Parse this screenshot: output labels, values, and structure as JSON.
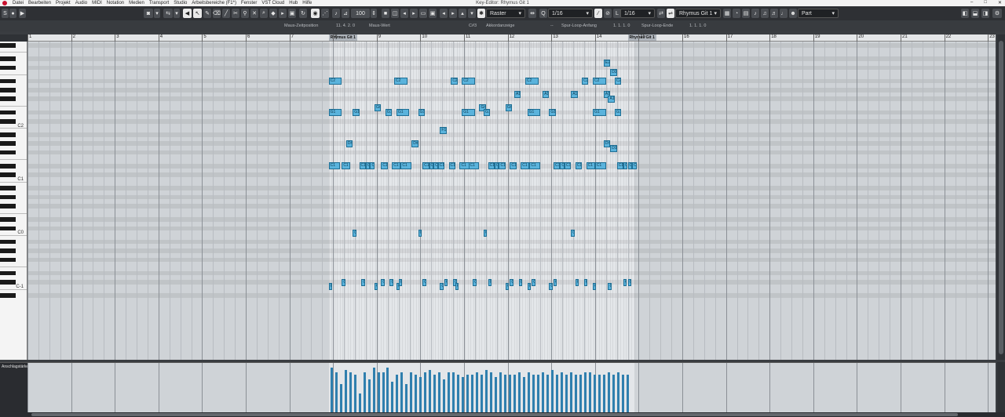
{
  "window": {
    "title": "Key-Editor: Rhymus Git 1"
  },
  "menu": [
    "Datei",
    "Bearbeiten",
    "Projekt",
    "Audio",
    "MIDI",
    "Notation",
    "Medien",
    "Transport",
    "Studio",
    "Arbeitsbereiche (F1*)",
    "Fenster",
    "VST Cloud",
    "Hub",
    "Hilfe"
  ],
  "toolbar": {
    "velocity": "100",
    "quantize_mode": "Raster",
    "quantize_value": "1/16",
    "length_value": "1/16",
    "length_prefix": "L",
    "quantize_prefix": "Q",
    "track": "Rhymus Git 1",
    "part_scope": "Part"
  },
  "infoline": {
    "mouse_pos_label": "Maus-Zeitposition",
    "mouse_pos_value": "11. 4. 2. 0",
    "mouse_value_label": "Maus-Wert",
    "mouse_value_value": "C#3",
    "chord_label": "Akkordanzeige",
    "chord_value": "--",
    "loop_start_label": "Spur-Loop-Anfang",
    "loop_start_value": "1. 1. 1. 0",
    "loop_end_label": "Spur-Loop-Ende",
    "loop_end_value": "1. 1. 1. 0"
  },
  "ruler": {
    "bars": [
      "1",
      "2",
      "3",
      "4",
      "5",
      "6",
      "7",
      "8",
      "9",
      "10",
      "11",
      "12",
      "13",
      "14",
      "15",
      "16",
      "17",
      "18",
      "19",
      "20",
      "21",
      "22",
      "23"
    ],
    "part_label_1": "Rhymus Git 1",
    "part_label_2": "Rhymus Git 1"
  },
  "keyboard": {
    "labels": [
      "C2",
      "C1",
      "C0",
      "C-1"
    ]
  },
  "velocity_lane": {
    "label": "Anschlagstärke"
  },
  "notes": [
    {
      "bar": 7.9,
      "len": 0.3,
      "p": 22,
      "t": "C2"
    },
    {
      "bar": 9.4,
      "len": 0.3,
      "p": 22,
      "t": "C2"
    },
    {
      "bar": 10.7,
      "len": 0.15,
      "p": 22,
      "t": "C2"
    },
    {
      "bar": 10.95,
      "len": 0.3,
      "p": 22,
      "t": "C2"
    },
    {
      "bar": 12.4,
      "len": 0.3,
      "p": 22,
      "t": "C2"
    },
    {
      "bar": 13.7,
      "len": 0.15,
      "p": 22,
      "t": "C2"
    },
    {
      "bar": 13.95,
      "len": 0.3,
      "p": 22,
      "t": "C2"
    },
    {
      "bar": 14.45,
      "len": 0.15,
      "p": 22,
      "t": "C2"
    },
    {
      "bar": 14.2,
      "len": 0.15,
      "p": 26,
      "t": "E2"
    },
    {
      "bar": 14.35,
      "len": 0.15,
      "p": 24,
      "t": "D2"
    },
    {
      "bar": 12.15,
      "len": 0.15,
      "p": 19,
      "t": "A1"
    },
    {
      "bar": 12.8,
      "len": 0.15,
      "p": 19,
      "t": "A1"
    },
    {
      "bar": 13.45,
      "len": 0.15,
      "p": 19,
      "t": "A1"
    },
    {
      "bar": 14.2,
      "len": 0.15,
      "p": 19,
      "t": "A1"
    },
    {
      "bar": 14.3,
      "len": 0.15,
      "p": 18,
      "t": "A1"
    },
    {
      "bar": 8.95,
      "len": 0.15,
      "p": 16,
      "t": "G#1"
    },
    {
      "bar": 11.35,
      "len": 0.15,
      "p": 16,
      "t": "G#1"
    },
    {
      "bar": 11.95,
      "len": 0.15,
      "p": 16,
      "t": "G#1"
    },
    {
      "bar": 7.9,
      "len": 0.3,
      "p": 15,
      "t": "G1"
    },
    {
      "bar": 8.45,
      "len": 0.15,
      "p": 15,
      "t": "G1"
    },
    {
      "bar": 9.2,
      "len": 0.15,
      "p": 15,
      "t": "G1"
    },
    {
      "bar": 9.45,
      "len": 0.3,
      "p": 15,
      "t": "G1"
    },
    {
      "bar": 9.95,
      "len": 0.15,
      "p": 15,
      "t": "G1"
    },
    {
      "bar": 10.95,
      "len": 0.3,
      "p": 15,
      "t": "G1"
    },
    {
      "bar": 11.45,
      "len": 0.15,
      "p": 15,
      "t": "G1"
    },
    {
      "bar": 12.45,
      "len": 0.3,
      "p": 15,
      "t": "G1"
    },
    {
      "bar": 12.95,
      "len": 0.15,
      "p": 15,
      "t": "G1"
    },
    {
      "bar": 13.95,
      "len": 0.3,
      "p": 15,
      "t": "G1"
    },
    {
      "bar": 14.45,
      "len": 0.15,
      "p": 15,
      "t": "G1"
    },
    {
      "bar": 10.45,
      "len": 0.15,
      "p": 11,
      "t": "F1"
    },
    {
      "bar": 8.3,
      "len": 0.15,
      "p": 8,
      "t": "D#1"
    },
    {
      "bar": 9.8,
      "len": 0.15,
      "p": 8,
      "t": "D#1"
    },
    {
      "bar": 14.2,
      "len": 0.15,
      "p": 8,
      "t": "D#1"
    },
    {
      "bar": 14.35,
      "len": 0.15,
      "p": 7,
      "t": "D1"
    },
    {
      "bar": 7.9,
      "len": 0.25,
      "p": 3,
      "t": "C1"
    },
    {
      "bar": 8.2,
      "len": 0.2,
      "p": 3,
      "t": "C1"
    },
    {
      "bar": 8.6,
      "len": 0.15,
      "p": 3,
      "t": "C1"
    },
    {
      "bar": 8.75,
      "len": 0.1,
      "p": 3,
      "t": "C1"
    },
    {
      "bar": 8.85,
      "len": 0.1,
      "p": 3,
      "t": "C1"
    },
    {
      "bar": 9.1,
      "len": 0.15,
      "p": 3,
      "t": "C1"
    },
    {
      "bar": 9.35,
      "len": 0.2,
      "p": 3,
      "t": "C1"
    },
    {
      "bar": 9.55,
      "len": 0.25,
      "p": 3,
      "t": "C1"
    },
    {
      "bar": 10.05,
      "len": 0.15,
      "p": 3,
      "t": "C1"
    },
    {
      "bar": 10.2,
      "len": 0.1,
      "p": 3,
      "t": "C1"
    },
    {
      "bar": 10.3,
      "len": 0.1,
      "p": 3,
      "t": "C1"
    },
    {
      "bar": 10.4,
      "len": 0.15,
      "p": 3,
      "t": "C1"
    },
    {
      "bar": 10.65,
      "len": 0.15,
      "p": 3,
      "t": "C1"
    },
    {
      "bar": 10.9,
      "len": 0.25,
      "p": 3,
      "t": "C1"
    },
    {
      "bar": 11.1,
      "len": 0.25,
      "p": 3,
      "t": "C1"
    },
    {
      "bar": 11.55,
      "len": 0.15,
      "p": 3,
      "t": "C1"
    },
    {
      "bar": 11.7,
      "len": 0.1,
      "p": 3,
      "t": "C1"
    },
    {
      "bar": 11.8,
      "len": 0.15,
      "p": 3,
      "t": "C1"
    },
    {
      "bar": 12.05,
      "len": 0.15,
      "p": 3,
      "t": "C1"
    },
    {
      "bar": 12.3,
      "len": 0.2,
      "p": 3,
      "t": "C1"
    },
    {
      "bar": 12.5,
      "len": 0.25,
      "p": 3,
      "t": "C1"
    },
    {
      "bar": 13.05,
      "len": 0.15,
      "p": 3,
      "t": "C1"
    },
    {
      "bar": 13.2,
      "len": 0.1,
      "p": 3,
      "t": "C1"
    },
    {
      "bar": 13.3,
      "len": 0.15,
      "p": 3,
      "t": "C1"
    },
    {
      "bar": 13.55,
      "len": 0.15,
      "p": 3,
      "t": "C1"
    },
    {
      "bar": 13.8,
      "len": 0.2,
      "p": 3,
      "t": "C1"
    },
    {
      "bar": 14.0,
      "len": 0.25,
      "p": 3,
      "t": "C1"
    },
    {
      "bar": 14.5,
      "len": 0.15,
      "p": 3,
      "t": "C1"
    },
    {
      "bar": 14.65,
      "len": 0.1,
      "p": 3,
      "t": "C1"
    },
    {
      "bar": 14.75,
      "len": 0.1,
      "p": 3,
      "t": "C1"
    },
    {
      "bar": 14.85,
      "len": 0.1,
      "p": 3,
      "t": "C1"
    },
    {
      "bar": 8.45,
      "len": 0.08,
      "p": -12,
      "t": "C"
    },
    {
      "bar": 9.95,
      "len": 0.08,
      "p": -12,
      "t": "C"
    },
    {
      "bar": 11.45,
      "len": 0.08,
      "p": -12,
      "t": "C"
    },
    {
      "bar": 13.45,
      "len": 0.08,
      "p": -12,
      "t": "C"
    },
    {
      "bar": 8.2,
      "len": 0.08,
      "p": -23,
      "t": "C"
    },
    {
      "bar": 8.65,
      "len": 0.08,
      "p": -23,
      "t": "C"
    },
    {
      "bar": 9.1,
      "len": 0.08,
      "p": -23,
      "t": "C"
    },
    {
      "bar": 9.3,
      "len": 0.08,
      "p": -23,
      "t": "C"
    },
    {
      "bar": 9.5,
      "len": 0.08,
      "p": -23,
      "t": "C"
    },
    {
      "bar": 10.05,
      "len": 0.08,
      "p": -23,
      "t": "C"
    },
    {
      "bar": 10.55,
      "len": 0.08,
      "p": -23,
      "t": "C"
    },
    {
      "bar": 10.75,
      "len": 0.08,
      "p": -23,
      "t": "C"
    },
    {
      "bar": 11.2,
      "len": 0.08,
      "p": -23,
      "t": "C"
    },
    {
      "bar": 11.55,
      "len": 0.08,
      "p": -23,
      "t": "C"
    },
    {
      "bar": 12.05,
      "len": 0.08,
      "p": -23,
      "t": "C"
    },
    {
      "bar": 12.25,
      "len": 0.08,
      "p": -23,
      "t": "C"
    },
    {
      "bar": 12.55,
      "len": 0.08,
      "p": -23,
      "t": "C"
    },
    {
      "bar": 13.05,
      "len": 0.08,
      "p": -23,
      "t": "C"
    },
    {
      "bar": 13.55,
      "len": 0.08,
      "p": -23,
      "t": "C"
    },
    {
      "bar": 13.75,
      "len": 0.08,
      "p": -23,
      "t": "C"
    },
    {
      "bar": 14.65,
      "len": 0.08,
      "p": -23,
      "t": "C"
    },
    {
      "bar": 14.75,
      "len": 0.08,
      "p": -23,
      "t": "C"
    },
    {
      "bar": 7.9,
      "len": 0.08,
      "p": -24,
      "t": "C"
    },
    {
      "bar": 8.95,
      "len": 0.08,
      "p": -24,
      "t": "C"
    },
    {
      "bar": 9.45,
      "len": 0.08,
      "p": -24,
      "t": "C"
    },
    {
      "bar": 10.45,
      "len": 0.08,
      "p": -24,
      "t": "C"
    },
    {
      "bar": 10.8,
      "len": 0.08,
      "p": -24,
      "t": "C"
    },
    {
      "bar": 11.95,
      "len": 0.08,
      "p": -24,
      "t": "C"
    },
    {
      "bar": 12.45,
      "len": 0.08,
      "p": -24,
      "t": "C"
    },
    {
      "bar": 12.95,
      "len": 0.08,
      "p": -24,
      "t": "C"
    },
    {
      "bar": 13.95,
      "len": 0.08,
      "p": -24,
      "t": "C"
    },
    {
      "bar": 14.3,
      "len": 0.08,
      "p": -24,
      "t": "C"
    }
  ],
  "velocities": [
    0.95,
    0.85,
    0.6,
    0.9,
    0.85,
    0.8,
    0.4,
    0.85,
    0.7,
    0.95,
    0.85,
    0.85,
    0.95,
    0.65,
    0.8,
    0.85,
    0.6,
    0.85,
    0.8,
    0.75,
    0.85,
    0.9,
    0.8,
    0.85,
    0.7,
    0.85,
    0.85,
    0.8,
    0.75,
    0.8,
    0.8,
    0.85,
    0.8,
    0.9,
    0.85,
    0.75,
    0.85,
    0.8,
    0.8,
    0.8,
    0.85,
    0.75,
    0.85,
    0.8,
    0.8,
    0.85,
    0.8,
    0.9,
    0.8,
    0.85,
    0.8,
    0.85,
    0.8,
    0.8,
    0.85,
    0.85,
    0.8,
    0.8,
    0.8,
    0.85,
    0.8,
    0.85,
    0.8,
    0.8
  ],
  "colors": {
    "note": "#5ab3dc",
    "note_border": "#1f6f95",
    "part_bg": "#e3e6e9",
    "grid_bg": "#cfd3d7",
    "velocity": "#2f7fae"
  }
}
